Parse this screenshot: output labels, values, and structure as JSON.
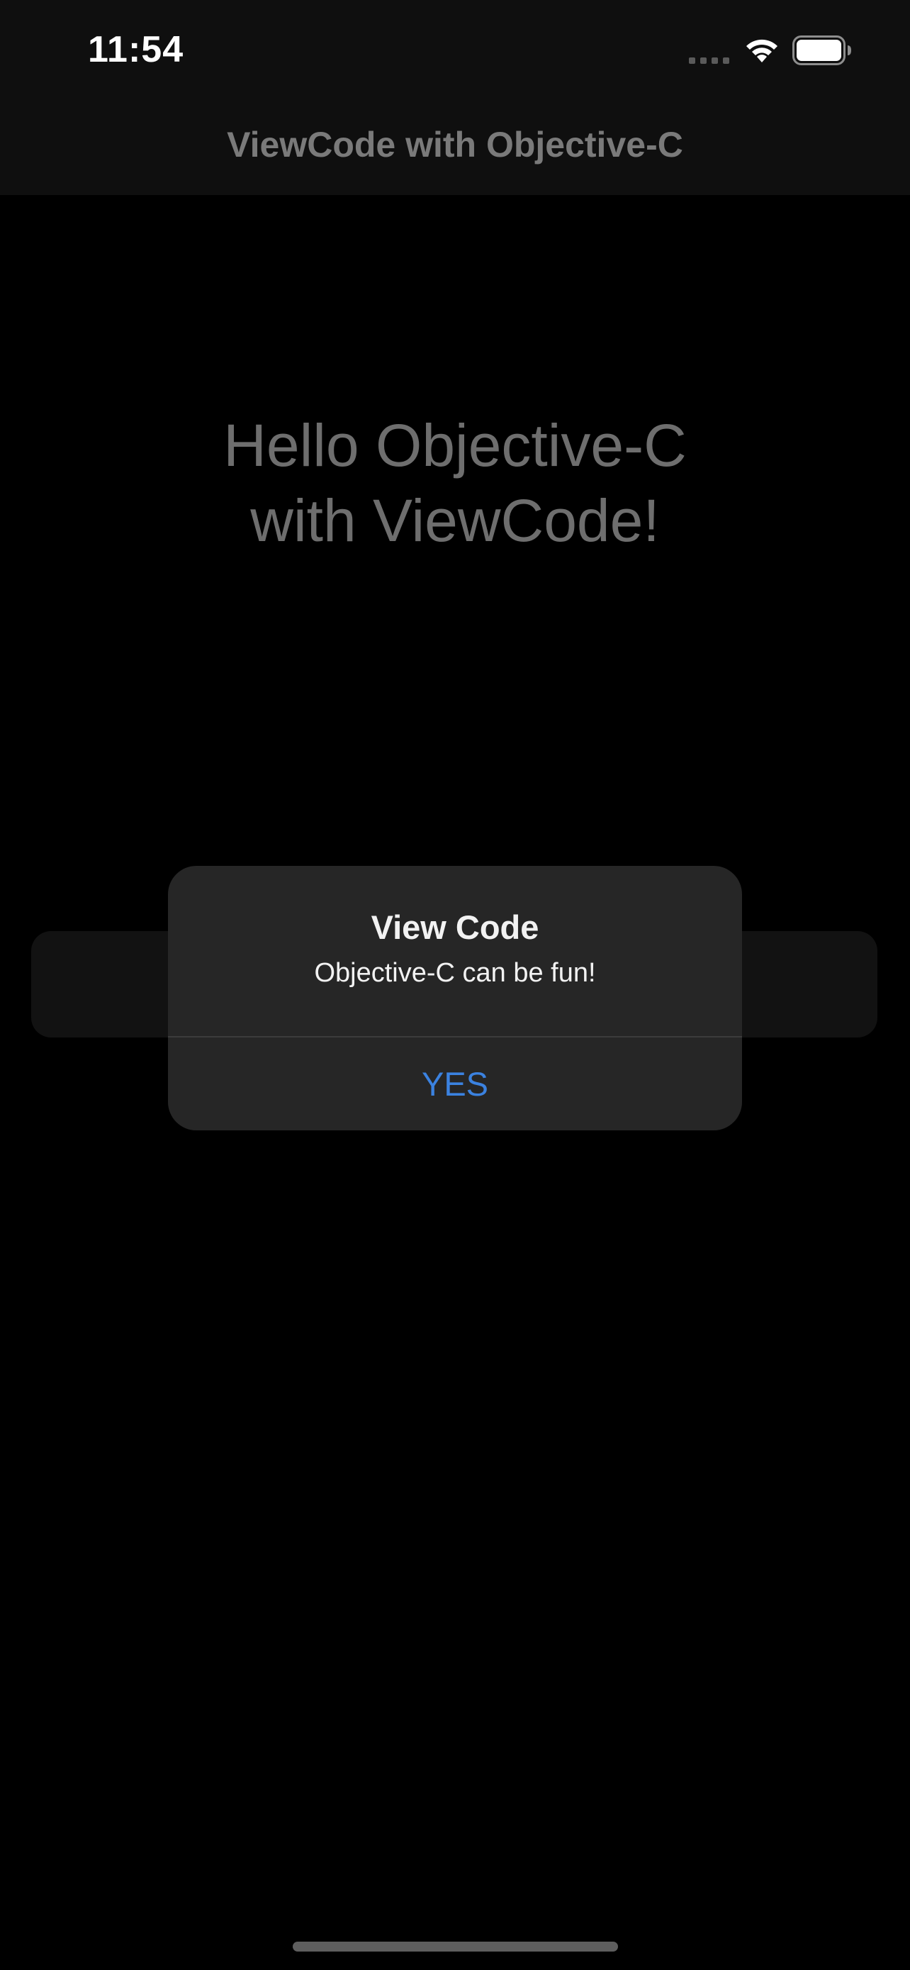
{
  "status_bar": {
    "time": "11:54",
    "icons": [
      "cellular-signal-icon",
      "wifi-icon",
      "battery-icon"
    ]
  },
  "nav": {
    "title": "ViewCode with Objective-C"
  },
  "main": {
    "hero_line1": "Hello Objective-C",
    "hero_line2": "with ViewCode!"
  },
  "alert": {
    "title": "View Code",
    "message": "Objective-C can be fun!",
    "button_label": "YES"
  },
  "colors": {
    "background": "#000000",
    "bar_background": "#0f0f0f",
    "alert_background": "#262626",
    "alert_button_text": "#3b82e0",
    "muted_text": "#6e6e6e"
  }
}
